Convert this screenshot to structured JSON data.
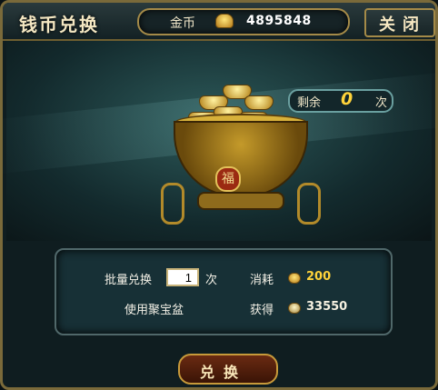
{
  "window": {
    "title": "钱币兑换",
    "close_label": "关闭"
  },
  "currency": {
    "label": "金币",
    "value": "4895848",
    "icon": "gold-coin-icon"
  },
  "remaining": {
    "label": "剩余",
    "value": "0",
    "unit": "次"
  },
  "form": {
    "batch_label": "批量兑换",
    "quantity_value": "1",
    "quantity_unit": "次",
    "use_box_label": "使用聚宝盆",
    "cost_label": "消耗",
    "cost_value": "200",
    "gain_label": "获得",
    "gain_value": "33550"
  },
  "actions": {
    "exchange_label": "兑换"
  },
  "colors": {
    "accent_gold": "#ffd33a",
    "frame": "#a48a48",
    "background": "#0f1d20"
  }
}
